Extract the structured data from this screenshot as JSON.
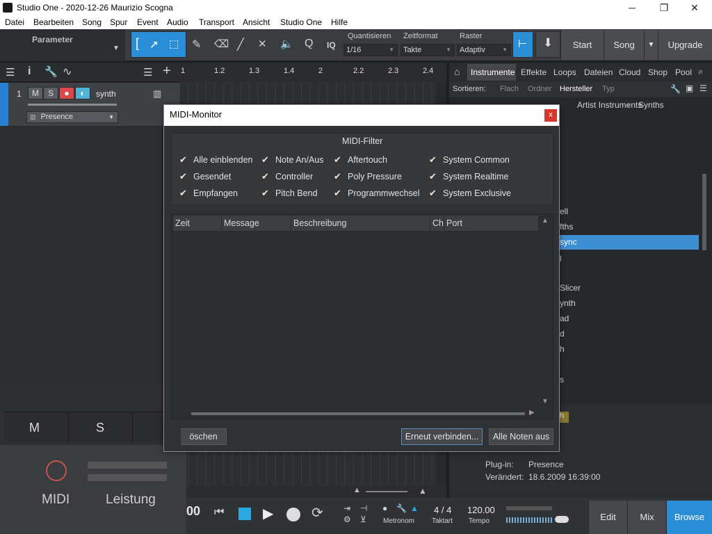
{
  "window": {
    "title": "Studio One - 2020-12-26 Maurizio Scogna",
    "minimize": "─",
    "maximize": "❐",
    "close": "✕"
  },
  "menubar": [
    "Datei",
    "Bearbeiten",
    "Song",
    "Spur",
    "Event",
    "Audio",
    "Transport",
    "Ansicht",
    "Studio One",
    "Hilfe"
  ],
  "toolbar": {
    "parameter_label": "Parameter",
    "quantize_label": "Quantisieren",
    "quantize_value": "1/16",
    "timeformat_label": "Zeitformat",
    "timeformat_value": "Takte",
    "grid_label": "Raster",
    "grid_value": "Adaptiv",
    "iq_label": "IQ",
    "start_label": "Start",
    "song_label": "Song",
    "upgrade_label": "Upgrade"
  },
  "ruler": {
    "ticks": [
      "1",
      "1.2",
      "1.3",
      "1.4",
      "2",
      "2.2",
      "2.3",
      "2.4"
    ]
  },
  "track": {
    "number": "1",
    "mute": "M",
    "solo": "S",
    "name": "synth",
    "instrument": "Presence"
  },
  "browser": {
    "tabs": [
      "Instrumente",
      "Effekte",
      "Loops",
      "Dateien",
      "Cloud",
      "Shop",
      "Pool"
    ],
    "sort_label": "Sortieren:",
    "sort_options": [
      "Flach",
      "Ordner",
      "Hersteller",
      "Typ"
    ],
    "breadcrumb": [
      "Artist Instruments",
      "Synths"
    ],
    "partial_items": [
      "ell",
      "fths",
      "sync",
      "l",
      "Slicer",
      "ynth",
      "ad",
      "d",
      "h",
      "s"
    ],
    "info": {
      "plugin_label": "Plug-in:",
      "plugin_value": "Presence",
      "changed_label": "Verändert:",
      "changed_value": "18.6.2009 16:39:00",
      "badge": "h"
    }
  },
  "bottom_left": {
    "m_label": "M",
    "s_label": "S",
    "midi_label": "MIDI",
    "perf_label": "Leistung"
  },
  "transport": {
    "time": "00",
    "signature": "4 / 4",
    "signature_label": "Taktart",
    "tempo": "120.00",
    "tempo_label": "Tempo",
    "metronome_label": "Metronom"
  },
  "footer_nav": {
    "edit": "Edit",
    "mix": "Mix",
    "browse": "Browse"
  },
  "dialog": {
    "title": "MIDI-Monitor",
    "close": "x",
    "filter_title": "MIDI-Filter",
    "filters": [
      [
        "Alle einblenden",
        "Note An/Aus",
        "Aftertouch",
        "System Common"
      ],
      [
        "Gesendet",
        "Controller",
        "Poly Pressure",
        "System Realtime"
      ],
      [
        "Empfangen",
        "Pitch Bend",
        "Programmwechsel",
        "System Exclusive"
      ]
    ],
    "columns": [
      "Zeit",
      "Message",
      "Beschreibung",
      "Ch",
      "Port"
    ],
    "clear_button": "öschen",
    "reconnect_button": "Erneut verbinden...",
    "all_notes_off_button": "Alle Noten aus"
  },
  "colors": {
    "accent": "#2a8ed6",
    "selected": "#3d8fd1",
    "record": "#e04848"
  }
}
